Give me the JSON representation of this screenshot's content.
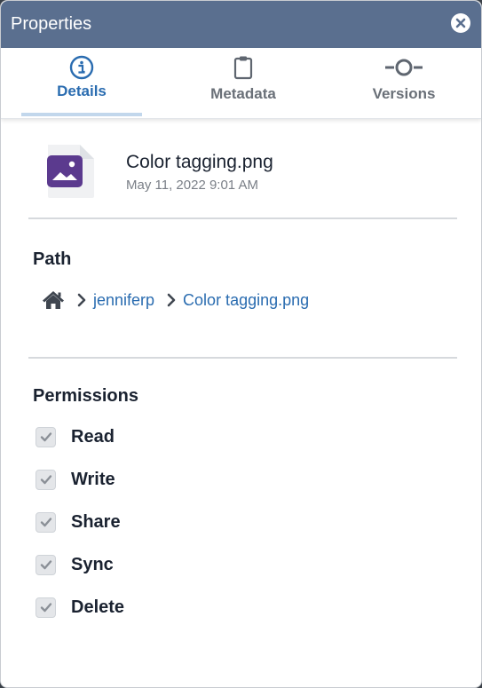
{
  "dialog": {
    "title": "Properties",
    "close_icon": "close-circle-icon"
  },
  "tabs": [
    {
      "label": "Details",
      "icon": "info-circle-icon",
      "active": true
    },
    {
      "label": "Metadata",
      "icon": "clipboard-icon",
      "active": false
    },
    {
      "label": "Versions",
      "icon": "versions-commit-icon",
      "active": false
    }
  ],
  "file": {
    "icon": "image-file-icon",
    "name": "Color tagging.png",
    "modified": "May 11, 2022 9:01 AM"
  },
  "path": {
    "title": "Path",
    "home_icon": "home-icon",
    "crumbs": [
      "jenniferp",
      "Color tagging.png"
    ]
  },
  "permissions": {
    "title": "Permissions",
    "items": [
      {
        "label": "Read",
        "checked": true
      },
      {
        "label": "Write",
        "checked": true
      },
      {
        "label": "Share",
        "checked": true
      },
      {
        "label": "Sync",
        "checked": true
      },
      {
        "label": "Delete",
        "checked": true
      }
    ]
  },
  "colors": {
    "titlebar": "#5a6f8f",
    "accent": "#2a6cb0",
    "file_icon": "#5b3a8e"
  }
}
